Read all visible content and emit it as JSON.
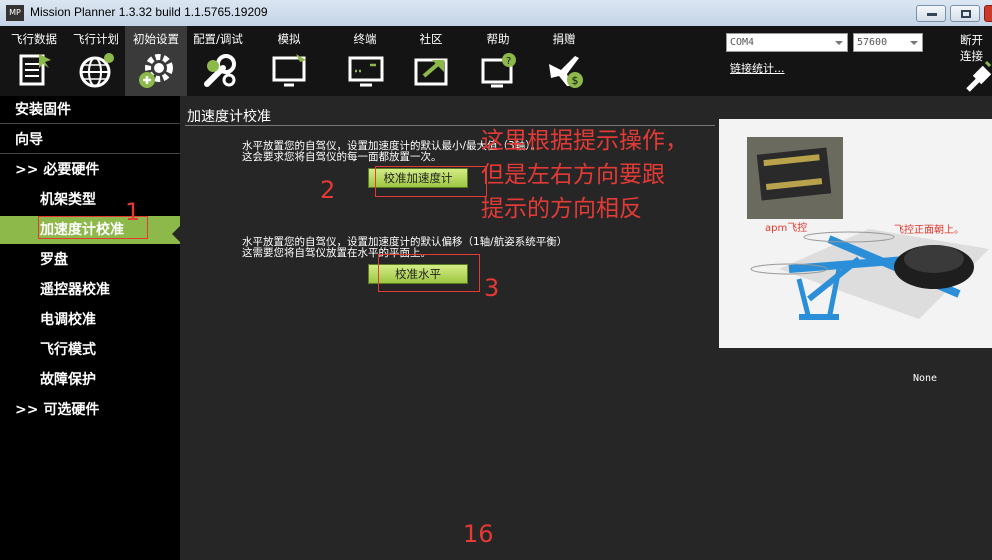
{
  "window": {
    "logo": "MP",
    "title": "Mission Planner 1.3.32 build 1.1.5765.19209"
  },
  "toolbar": {
    "items": [
      {
        "label": "飞行数据",
        "icon": "flight-data-icon"
      },
      {
        "label": "飞行计划",
        "icon": "flight-plan-globe-icon"
      },
      {
        "label": "初始设置",
        "icon": "initial-setup-gear-icon"
      },
      {
        "label": "配置/调试",
        "icon": "config-tuning-wrench-icon"
      },
      {
        "label": "模拟",
        "icon": "simulation-monitor-icon"
      },
      {
        "label": "终端",
        "icon": "terminal-monitor-icon"
      },
      {
        "label": "社区",
        "icon": "community-share-icon"
      },
      {
        "label": "帮助",
        "icon": "help-monitor-icon"
      },
      {
        "label": "捐赠",
        "icon": "donate-plane-icon"
      }
    ],
    "port": "COM4",
    "baud": "57600",
    "link_stats": "链接统计...",
    "disconnect_label": "断开连接"
  },
  "sidebar": {
    "items": [
      {
        "label": "安装固件"
      },
      {
        "label": "向导"
      },
      {
        "label": ">> 必要硬件"
      },
      {
        "label": "机架类型"
      },
      {
        "label": "加速度计校准"
      },
      {
        "label": "罗盘"
      },
      {
        "label": "遥控器校准"
      },
      {
        "label": "电调校准"
      },
      {
        "label": "飞行模式"
      },
      {
        "label": "故障保护"
      },
      {
        "label": ">> 可选硬件"
      }
    ],
    "active_index": 4
  },
  "main": {
    "title": "加速度计校准",
    "accel": {
      "line1": "水平放置您的自驾仪，设置加速度计的默认最小/最大值（3轴）。",
      "line2": "这会要求您将自驾仪的每一面都放置一次。",
      "button": "校准加速度计"
    },
    "level": {
      "line1": "水平放置您的自驾仪，设置加速度计的默认偏移（1轴/航姿系统平衡）",
      "line2": "这需要您将自驾仪放置在水平的平面上。",
      "button": "校准水平"
    },
    "status": "None",
    "photo": {
      "label_apm": "apm飞控",
      "label_front": "飞控正面朝上。"
    }
  },
  "annotations": {
    "text_lines": [
      "这里根据提示操作，",
      "但是左右方向要跟",
      "提示的方向相反"
    ],
    "n1": "1",
    "n2": "2",
    "n3": "3",
    "n16": "16"
  },
  "colors": {
    "accent_green": "#8db84a",
    "annotation_red": "#e33a36",
    "panel_bg": "#262626",
    "toolbar_bg": "#141414"
  }
}
